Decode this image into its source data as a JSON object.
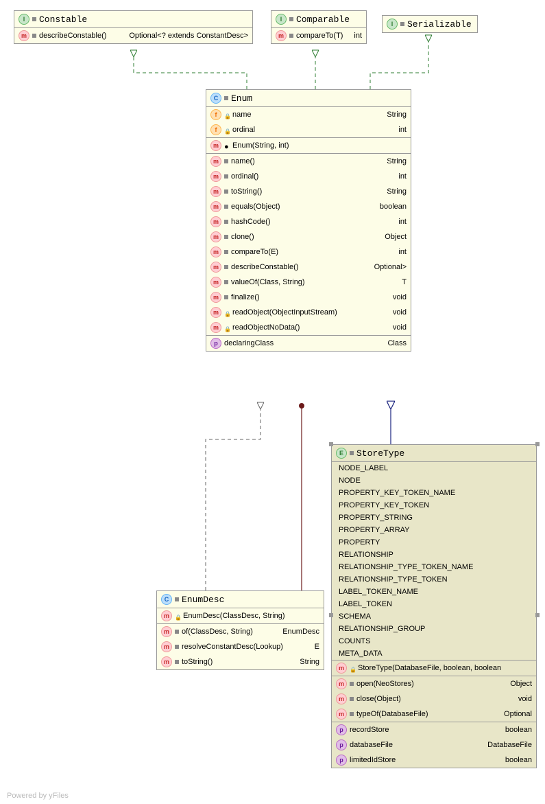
{
  "footer": "Powered by yFiles",
  "interfaces": {
    "constable": {
      "name": "Constable",
      "methods": [
        {
          "sig": "describeConstable()",
          "ret": "Optional<? extends ConstantDesc>"
        }
      ]
    },
    "comparable": {
      "name": "Comparable",
      "methods": [
        {
          "sig": "compareTo(T)",
          "ret": "int"
        }
      ]
    },
    "serializable": {
      "name": "Serializable"
    }
  },
  "enumClass": {
    "name": "Enum",
    "fields": [
      {
        "name": "name",
        "type": "String"
      },
      {
        "name": "ordinal",
        "type": "int"
      }
    ],
    "ctor": {
      "sig": "Enum(String, int)"
    },
    "methods": [
      {
        "sig": "name()",
        "ret": "String"
      },
      {
        "sig": "ordinal()",
        "ret": "int"
      },
      {
        "sig": "toString()",
        "ret": "String"
      },
      {
        "sig": "equals(Object)",
        "ret": "boolean"
      },
      {
        "sig": "hashCode()",
        "ret": "int"
      },
      {
        "sig": "clone()",
        "ret": "Object"
      },
      {
        "sig": "compareTo(E)",
        "ret": "int"
      },
      {
        "sig": "describeConstable()",
        "ret": "Optional<EnumDesc<E>>"
      },
      {
        "sig": "valueOf(Class<T>, String)",
        "ret": "T"
      },
      {
        "sig": "finalize()",
        "ret": "void"
      },
      {
        "sig": "readObject(ObjectInputStream)",
        "ret": "void",
        "locked": true
      },
      {
        "sig": "readObjectNoData()",
        "ret": "void",
        "locked": true
      }
    ],
    "props": [
      {
        "name": "declaringClass",
        "type": "Class<E>"
      }
    ]
  },
  "enumDesc": {
    "name": "EnumDesc",
    "ctor": {
      "sig": "EnumDesc(ClassDesc, String)",
      "locked": true
    },
    "methods": [
      {
        "sig": "of(ClassDesc, String)",
        "ret": "EnumDesc<E>"
      },
      {
        "sig": "resolveConstantDesc(Lookup)",
        "ret": "E"
      },
      {
        "sig": "toString()",
        "ret": "String"
      }
    ]
  },
  "storeType": {
    "name": "StoreType",
    "constants": [
      "NODE_LABEL",
      "NODE",
      "PROPERTY_KEY_TOKEN_NAME",
      "PROPERTY_KEY_TOKEN",
      "PROPERTY_STRING",
      "PROPERTY_ARRAY",
      "PROPERTY",
      "RELATIONSHIP",
      "RELATIONSHIP_TYPE_TOKEN_NAME",
      "RELATIONSHIP_TYPE_TOKEN",
      "LABEL_TOKEN_NAME",
      "LABEL_TOKEN",
      "SCHEMA",
      "RELATIONSHIP_GROUP",
      "COUNTS",
      "META_DATA"
    ],
    "ctor": {
      "sig": "StoreType(DatabaseFile, boolean, boolean",
      "locked": true
    },
    "methods": [
      {
        "sig": "open(NeoStores)",
        "ret": "Object"
      },
      {
        "sig": "close(Object)",
        "ret": "void"
      },
      {
        "sig": "typeOf(DatabaseFile)",
        "ret": "Optional<StoreType>"
      }
    ],
    "props": [
      {
        "name": "recordStore",
        "type": "boolean"
      },
      {
        "name": "databaseFile",
        "type": "DatabaseFile"
      },
      {
        "name": "limitedIdStore",
        "type": "boolean"
      }
    ]
  }
}
